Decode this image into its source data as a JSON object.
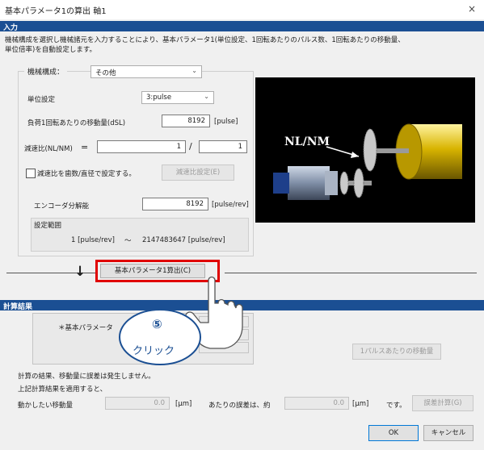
{
  "window": {
    "title": "基本パラメータ1の算出 軸1",
    "close_glyph": "×"
  },
  "input_section": {
    "header": "入力",
    "description_line1": "機械構成を選択し機械諸元を入力することにより、基本パラメータ1(単位設定、1回転あたりのパルス数、1回転あたりの移動量、",
    "description_line2": "単位倍率)を自動設定します。"
  },
  "machine": {
    "label": "機械構成：",
    "value": "その他"
  },
  "unit_setting": {
    "label": "単位設定",
    "value": "3:pulse"
  },
  "travel": {
    "label": "負荷1回転あたりの移動量(dSL)",
    "value": "8192",
    "unit": "[pulse]"
  },
  "reduction": {
    "label": "減速比(NL/NM)",
    "eq": "=",
    "nl": "1",
    "slash": "/",
    "nm": "1"
  },
  "gear_checkbox": {
    "label": "減速比を歯数/直径で設定する。",
    "button": "減速比設定(E)"
  },
  "encoder": {
    "label": "エンコーダ分解能",
    "value": "8192",
    "unit": "[pulse/rev]"
  },
  "range": {
    "label": "設定範囲",
    "min": "1 [pulse/rev]",
    "tilde": "〜",
    "max": "2147483647 [pulse/rev]"
  },
  "image": {
    "label": "NL/NM",
    "colors": {
      "cylinder": "#c9a400",
      "gear": "#bdbdbd"
    }
  },
  "calc_button": {
    "label": "基本パラメータ1算出(C)",
    "arrow": "↓"
  },
  "result_section": {
    "header": "計算結果",
    "param_label": "＊基本パラメータ",
    "per_pulse_button": "1パルスあたりの移動量"
  },
  "annotation": {
    "number": "⑤",
    "text": "クリック",
    "color": "#1b4f93",
    "highlight": "#e00000"
  },
  "messages": {
    "error_note": "計算の結果、移動量に誤差は発生しません。",
    "apply_note": "上記計算結果を適用すると、"
  },
  "movement": {
    "label": "動かしたい移動量",
    "value": "0.0",
    "unit": "[μm]",
    "per_label": "あたりの誤差は、約",
    "err_value": "0.0",
    "err_unit": "[μm]",
    "desu": "です。",
    "calc_button": "誤差計算(G)"
  },
  "footer": {
    "ok": "OK",
    "cancel": "キャンセル"
  }
}
